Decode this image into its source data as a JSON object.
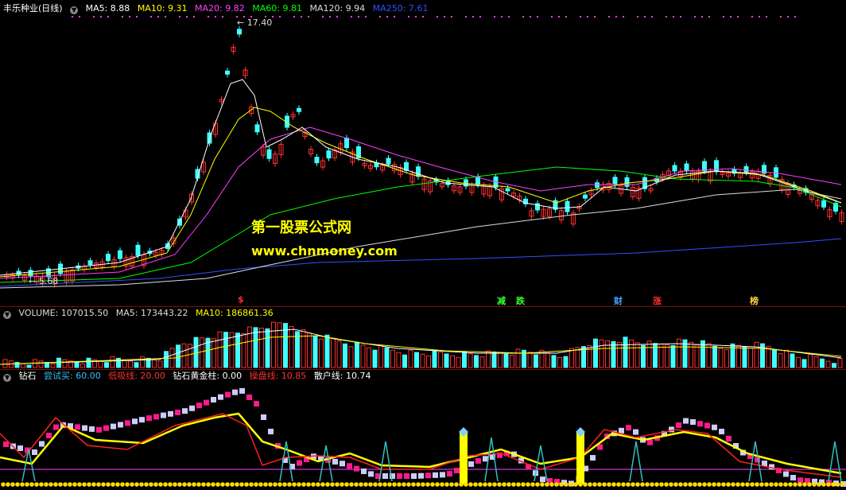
{
  "main": {
    "symbol": "丰乐种业(日线)",
    "ma": [
      {
        "label": "MA5: 8.88",
        "color": "#ffffff"
      },
      {
        "label": "MA10: 9.31",
        "color": "#ffff00"
      },
      {
        "label": "MA20: 9.82",
        "color": "#ff40ff"
      },
      {
        "label": "MA60: 9.81",
        "color": "#00ff00"
      },
      {
        "label": "MA120: 9.94",
        "color": "#dddddd"
      },
      {
        "label": "MA250: 7.61",
        "color": "#3050ff"
      }
    ],
    "high_label": "17.40",
    "low_label": "5.68",
    "markers": [
      {
        "text": "$",
        "color": "#ff3030"
      },
      {
        "text": "减",
        "color": "#30ff30"
      },
      {
        "text": "跌",
        "color": "#30ff30"
      },
      {
        "text": "财",
        "color": "#40a0ff"
      },
      {
        "text": "涨",
        "color": "#ff3030"
      },
      {
        "text": "榜",
        "color": "#ffd040"
      }
    ],
    "watermark_cn": "第一股票公式网",
    "watermark_url": "www.chnmoney.com"
  },
  "volume": {
    "labels": [
      {
        "text": "VOLUME: 107015.50",
        "color": "#dddddd"
      },
      {
        "text": "MA5: 173443.22",
        "color": "#dddddd"
      },
      {
        "text": "MA10: 186861.36",
        "color": "#ffff00"
      }
    ]
  },
  "indicator": {
    "name": "钻石",
    "labels": [
      {
        "text": "尝试买: 60.00",
        "color": "#30c0ff"
      },
      {
        "text": "低吸线: 20.00",
        "color": "#ff3030"
      },
      {
        "text": "钻石黄金柱: 0.00",
        "color": "#ffffff"
      },
      {
        "text": "操盘线: 10.85",
        "color": "#ff3030"
      },
      {
        "text": "散户线: 10.74",
        "color": "#ffffff"
      }
    ]
  },
  "icons": {
    "panel_toggle": "chevron-down-icon"
  }
}
